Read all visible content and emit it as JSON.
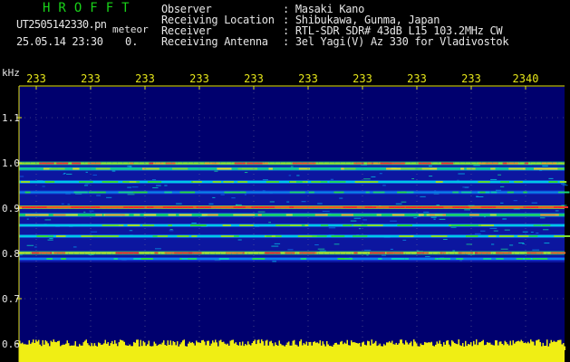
{
  "header": {
    "logo": "HROFFT",
    "filename": "UT2505142330.pn",
    "mode": "meteor",
    "datetime": "25.05.14 23:30",
    "extra": "0.",
    "info": [
      {
        "label": "Observer",
        "value": ": Masaki Kano"
      },
      {
        "label": "Receiving Location",
        "value": ": Shibukawa, Gunma, Japan"
      },
      {
        "label": "Receiver",
        "value": ": RTL-SDR SDR# 43dB L15 103.2MHz CW"
      },
      {
        "label": "Receiving Antenna",
        "value": ": 3el Yagi(V) Az 330 for Vladivostok"
      }
    ]
  },
  "colors": {
    "background": "#000000",
    "text": "#e6e6e6",
    "accent_green": "#19d219",
    "axis_yellow": "#e6e619",
    "plot_background": "#00006e"
  },
  "chart_data": {
    "type": "heatmap",
    "ylabel": "kHz",
    "x_tick_labels": [
      "233",
      "233",
      "233",
      "233",
      "233",
      "233",
      "233",
      "233",
      "233",
      "2340"
    ],
    "y_ticks": [
      1.1,
      1.0,
      0.9,
      0.8,
      0.7,
      0.6
    ],
    "y_tick_labels": [
      "1.1",
      "1.0",
      "0.9",
      "0.8",
      "0.7",
      "0.6"
    ],
    "ylim": [
      0.59,
      1.2
    ],
    "grid": true,
    "signal_bands_khz": [
      {
        "freq": 0.999,
        "intensity": 0.72
      },
      {
        "freq": 0.987,
        "intensity": 0.55
      },
      {
        "freq": 0.958,
        "intensity": 0.45
      },
      {
        "freq": 0.935,
        "intensity": 0.35
      },
      {
        "freq": 0.902,
        "intensity": 0.95
      },
      {
        "freq": 0.885,
        "intensity": 0.6
      },
      {
        "freq": 0.862,
        "intensity": 0.45
      },
      {
        "freq": 0.838,
        "intensity": 0.45
      },
      {
        "freq": 0.801,
        "intensity": 0.75
      },
      {
        "freq": 0.788,
        "intensity": 0.35
      }
    ],
    "noise_floor_band_khz": [
      0.78,
      1.0
    ]
  }
}
